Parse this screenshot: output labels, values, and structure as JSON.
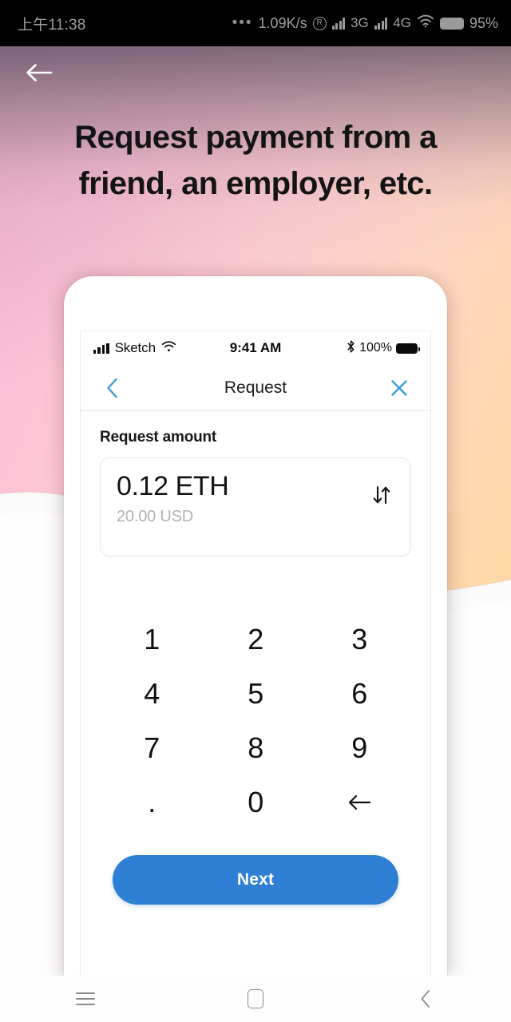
{
  "android_status": {
    "clock": "上午11:38",
    "overflow_dots": "•••",
    "net_speed": "1.09K/s",
    "roaming_badge": "R",
    "network_1": "3G",
    "network_2": "4G",
    "battery_percent": "95%",
    "icons": {
      "signal": "signal-bars-icon",
      "wifi": "wifi-icon",
      "battery": "battery-icon"
    }
  },
  "hero": {
    "back_icon": "back-arrow-icon",
    "title": "Request payment from a friend, an employer, etc.",
    "gradient": {
      "pink": "#fbb7d2",
      "peach": "#ffd7c3",
      "amber": "#f6cf92",
      "mauve_haze": "#5f4e5f",
      "paper_white": "#fbfbfb"
    }
  },
  "phone": {
    "ios_status": {
      "carrier": "Sketch",
      "time": "9:41 AM",
      "battery_percent": "100%",
      "icons": {
        "signal": "cellular-bars-icon",
        "wifi": "wifi-icon",
        "bluetooth": "bluetooth-icon",
        "battery": "battery-icon"
      }
    },
    "nav": {
      "back_icon": "chevron-left-icon",
      "title": "Request",
      "close_icon": "close-x-icon",
      "accent_color": "#3b9ad9"
    },
    "form": {
      "section_label": "Request amount",
      "amount_primary": "0.12 ETH",
      "amount_secondary": "20.00 USD",
      "swap_icon": "swap-vertical-icon"
    },
    "keypad": [
      {
        "label": "1",
        "name": "key-1"
      },
      {
        "label": "2",
        "name": "key-2"
      },
      {
        "label": "3",
        "name": "key-3"
      },
      {
        "label": "4",
        "name": "key-4"
      },
      {
        "label": "5",
        "name": "key-5"
      },
      {
        "label": "6",
        "name": "key-6"
      },
      {
        "label": "7",
        "name": "key-7"
      },
      {
        "label": "8",
        "name": "key-8"
      },
      {
        "label": "9",
        "name": "key-9"
      },
      {
        "label": ".",
        "name": "key-decimal"
      },
      {
        "label": "0",
        "name": "key-0"
      },
      {
        "label": "←",
        "name": "key-backspace"
      }
    ],
    "next_button": {
      "label": "Next",
      "color": "#2f80d4"
    }
  },
  "android_nav": {
    "recents_icon": "menu-icon",
    "home_icon": "home-square-icon",
    "back_icon": "back-chevron-icon"
  }
}
